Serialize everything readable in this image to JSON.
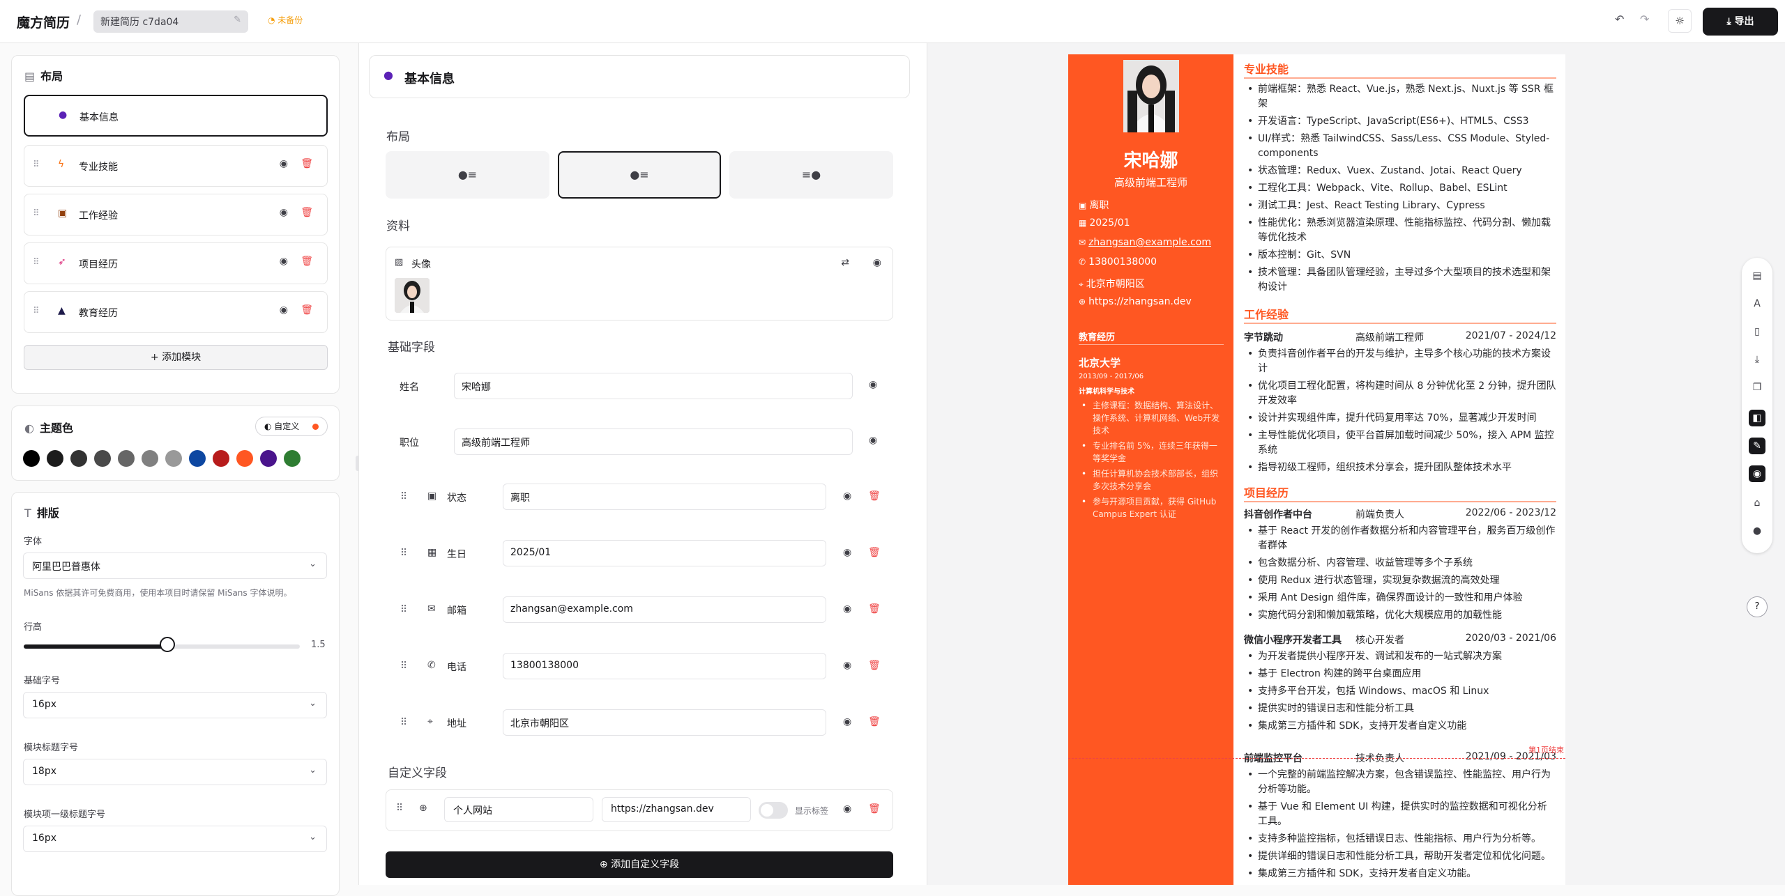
{
  "topbar": {
    "brand": "魔方简历",
    "separator": "/",
    "doc_title": "新建简历 c7da04",
    "save_status": "未备份",
    "export_label": "导出"
  },
  "layout_panel": {
    "title": "布局",
    "modules": [
      {
        "label": "基本信息",
        "icon": "user-icon",
        "active": true
      },
      {
        "label": "专业技能",
        "icon": "lightning-icon"
      },
      {
        "label": "工作经验",
        "icon": "briefcase-icon"
      },
      {
        "label": "项目经历",
        "icon": "rocket-icon"
      },
      {
        "label": "教育经历",
        "icon": "graduation-cap-icon"
      }
    ],
    "add_module": "添加模块"
  },
  "theme": {
    "title": "主题色",
    "custom_label": "自定义",
    "colors": [
      "#000000",
      "#1c1c1c",
      "#333333",
      "#4a4a4a",
      "#666666",
      "#808080",
      "#999999",
      "#0d47a1",
      "#b71c1c",
      "#ff5722",
      "#4a148c",
      "#2e7d32"
    ]
  },
  "typography": {
    "title": "排版",
    "font_label": "字体",
    "font_value": "阿里巴巴普惠体",
    "font_hint": "MiSans 依据其许可免费商用，使用本项目时请保留 MiSans 字体说明。",
    "line_height_label": "行高",
    "line_height_value": "1.5",
    "line_height_fraction": 0.52,
    "base_size_label": "基础字号",
    "base_size_value": "16px",
    "module_title_size_label": "模块标题字号",
    "module_title_size_value": "18px",
    "module_item_size_label": "模块项一级标题字号",
    "module_item_size_value": "16px"
  },
  "editor": {
    "header": "基本信息",
    "layout_label": "布局",
    "profile_label": "资料",
    "avatar_label": "头像",
    "basic_fields_label": "基础字段",
    "name_label": "姓名",
    "name_value": "宋哈娜",
    "position_label": "职位",
    "position_value": "高级前端工程师",
    "fields": [
      {
        "label": "状态",
        "value": "离职",
        "icon": "briefcase-icon"
      },
      {
        "label": "生日",
        "value": "2025/01",
        "icon": "calendar-icon"
      },
      {
        "label": "邮箱",
        "value": "zhangsan@example.com",
        "icon": "mail-icon"
      },
      {
        "label": "电话",
        "value": "13800138000",
        "icon": "phone-icon"
      },
      {
        "label": "地址",
        "value": "北京市朝阳区",
        "icon": "map-pin-icon"
      }
    ],
    "custom_fields_label": "自定义字段",
    "custom_field": {
      "name": "个人网站",
      "value": "https://zhangsan.dev",
      "show_label": "显示标签"
    },
    "add_custom_field": "添加自定义字段"
  },
  "resume": {
    "accent": "#ff5722",
    "name": "宋哈娜",
    "title": "高级前端工程师",
    "status": "离职",
    "birthday": "2025/01",
    "email": "zhangsan@example.com",
    "phone": "13800138000",
    "address": "北京市朝阳区",
    "website": "https://zhangsan.dev",
    "education": {
      "heading": "教育经历",
      "school": "北京大学",
      "dates": "2013/09 - 2017/06",
      "major": "计算机科学与技术",
      "items": [
        "主修课程：数据结构、算法设计、操作系统、计算机网络、Web开发技术",
        "专业排名前 5%，连续三年获得一等奖学金",
        "担任计算机协会技术部部长，组织多次技术分享会",
        "参与开源项目贡献，获得 GitHub Campus Expert 认证"
      ]
    },
    "skills": {
      "heading": "专业技能",
      "items": [
        "前端框架：熟悉 React、Vue.js，熟悉 Next.js、Nuxt.js 等 SSR 框架",
        "开发语言：TypeScript、JavaScript(ES6+)、HTML5、CSS3",
        "UI/样式：熟悉 TailwindCSS、Sass/Less、CSS Module、Styled-components",
        "状态管理：Redux、Vuex、Zustand、Jotai、React Query",
        "工程化工具：Webpack、Vite、Rollup、Babel、ESLint",
        "测试工具：Jest、React Testing Library、Cypress",
        "性能优化：熟悉浏览器渲染原理、性能指标监控、代码分割、懒加载等优化技术",
        "版本控制：Git、SVN",
        "技术管理：具备团队管理经验，主导过多个大型项目的技术选型和架构设计"
      ]
    },
    "work": {
      "heading": "工作经验",
      "company": "字节跳动",
      "role": "高级前端工程师",
      "dates": "2021/07 - 2024/12",
      "items": [
        "负责抖音创作者平台的开发与维护，主导多个核心功能的技术方案设计",
        "优化项目工程化配置，将构建时间从 8 分钟优化至 2 分钟，提升团队开发效率",
        "设计并实现组件库，提升代码复用率达 70%，显著减少开发时间",
        "主导性能优化项目，使平台首屏加载时间减少 50%，接入 APM 监控系统",
        "指导初级工程师，组织技术分享会，提升团队整体技术水平"
      ]
    },
    "projects": {
      "heading": "项目经历",
      "list": [
        {
          "name": "抖音创作者中台",
          "role": "前端负责人",
          "dates": "2022/06 - 2023/12",
          "items": [
            "基于 React 开发的创作者数据分析和内容管理平台，服务百万级创作者群体",
            "包含数据分析、内容管理、收益管理等多个子系统",
            "使用 Redux 进行状态管理，实现复杂数据流的高效处理",
            "采用 Ant Design 组件库，确保界面设计的一致性和用户体验",
            "实施代码分割和懒加载策略，优化大规模应用的加载性能"
          ]
        },
        {
          "name": "微信小程序开发者工具",
          "role": "核心开发者",
          "dates": "2020/03 - 2021/06",
          "items": [
            "为开发者提供小程序开发、调试和发布的一站式解决方案",
            "基于 Electron 构建的跨平台桌面应用",
            "支持多平台开发，包括 Windows、macOS 和 Linux",
            "提供实时的错误日志和性能分析工具",
            "集成第三方插件和 SDK，支持开发者自定义功能"
          ]
        },
        {
          "name": "前端监控平台",
          "role": "技术负责人",
          "dates": "2021/09 - 2021/03",
          "items": [
            "一个完整的前端监控解决方案，包含错误监控、性能监控、用户行为分析等功能。",
            "基于 Vue 和 Element UI 构建，提供实时的监控数据和可视化分析工具。",
            "支持多种监控指标，包括错误日志、性能指标、用户行为分析等。",
            "提供详细的错误日志和性能分析工具，帮助开发者定位和优化问题。",
            "集成第三方插件和 SDK，支持开发者自定义功能。"
          ]
        }
      ]
    },
    "page_break_label": "第1页结束"
  }
}
